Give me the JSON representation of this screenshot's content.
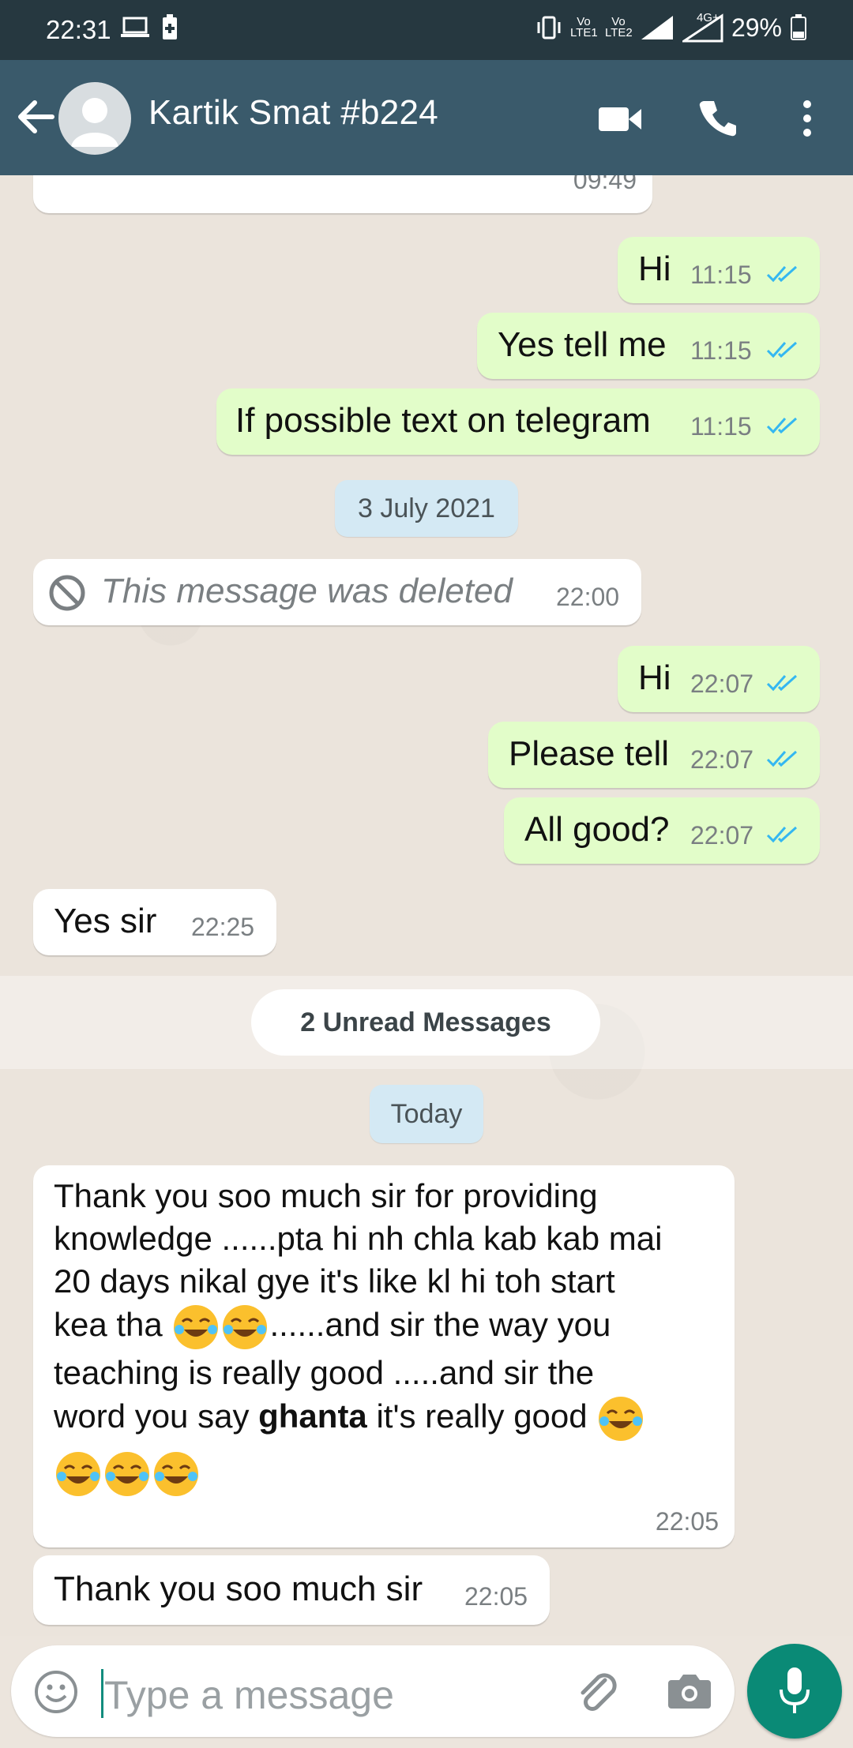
{
  "status_bar": {
    "time": "22:31",
    "battery": "29%",
    "network_labels": [
      "Vo LTE1",
      "Vo LTE2",
      "4G+"
    ]
  },
  "header": {
    "contact_name": "Kartik Smat #b224"
  },
  "messages": [
    {
      "dir": "in",
      "text": "",
      "time": "09:49"
    },
    {
      "dir": "out",
      "text": "Hi",
      "time": "11:15"
    },
    {
      "dir": "out",
      "text": "Yes tell me",
      "time": "11:15"
    },
    {
      "dir": "out",
      "text": "If possible text on telegram",
      "time": "11:15"
    },
    {
      "dir": "date",
      "text": "3 July 2021"
    },
    {
      "dir": "in",
      "text": "This message was deleted",
      "time": "22:00",
      "deleted": true
    },
    {
      "dir": "out",
      "text": "Hi",
      "time": "22:07"
    },
    {
      "dir": "out",
      "text": "Please tell",
      "time": "22:07"
    },
    {
      "dir": "out",
      "text": "All good?",
      "time": "22:07"
    },
    {
      "dir": "in",
      "text": "Yes sir",
      "time": "22:25"
    },
    {
      "dir": "unread",
      "text": "2 Unread Messages"
    },
    {
      "dir": "date",
      "text": "Today"
    },
    {
      "dir": "in",
      "lines": [
        "Thank you soo much sir for providing",
        "knowledge ......pta hi nh chla kab kab mai",
        "20 days nikal gye it's like kl hi toh start",
        "kea tha",
        "......and sir the way you",
        "teaching is really good .....and sir the",
        "word you say",
        "ghanta",
        "it's really good"
      ],
      "time": "22:05"
    },
    {
      "dir": "in",
      "text": "Thank you soo much sir",
      "time": "22:05"
    }
  ],
  "input": {
    "placeholder": "Type a message"
  },
  "icons": {
    "back": "arrow-left-icon",
    "video": "video-call-icon",
    "call": "phone-icon",
    "menu": "more-vert-icon",
    "emoji": "emoji-icon",
    "attach": "paperclip-icon",
    "camera": "camera-icon",
    "mic": "mic-icon",
    "read": "double-check-icon",
    "deleted": "blocked-icon"
  },
  "colors": {
    "header": "#3a5a6b",
    "statusbar": "#263840",
    "outgoing": "#e2fdc9",
    "read_ticks": "#34b7f1",
    "mic": "#0a8a76"
  }
}
